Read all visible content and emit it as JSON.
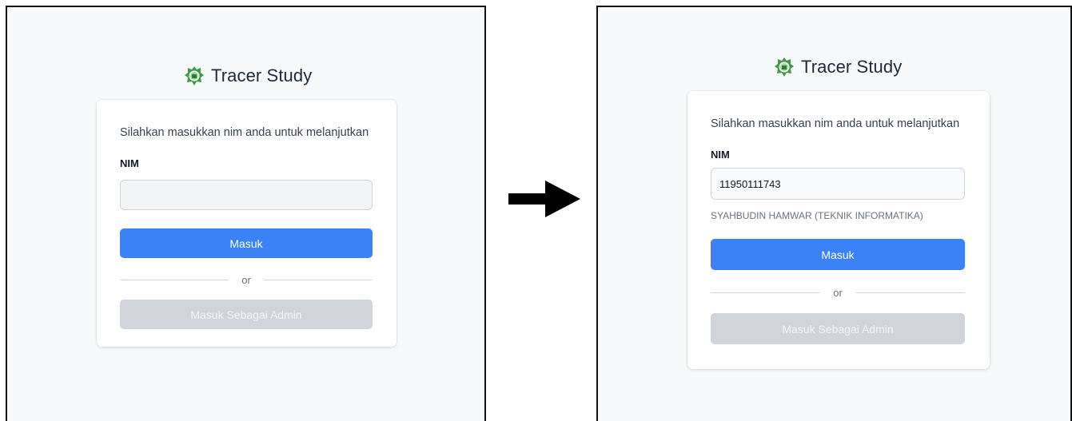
{
  "colors": {
    "primary": "#3b82f6",
    "disabled": "#d1d5db",
    "background": "#f8f9fb"
  },
  "before": {
    "brand": {
      "title": "Tracer Study",
      "logo_icon": "university-logo-icon"
    },
    "prompt": "Silahkan masukkan nim anda untuk melanjutkan",
    "nim_label": "NIM",
    "nim_value": "",
    "nim_placeholder": "",
    "login_button": "Masuk",
    "divider_text": "or",
    "admin_button": "Masuk Sebagai Admin"
  },
  "transition_icon": "arrow-right-icon",
  "after": {
    "brand": {
      "title": "Tracer Study",
      "logo_icon": "university-logo-icon"
    },
    "prompt": "Silahkan masukkan nim anda untuk melanjutkan",
    "nim_label": "NIM",
    "nim_value": "11950111743",
    "student_name": "SYAHBUDIN HAMWAR (TEKNIK INFORMATIKA)",
    "login_button": "Masuk",
    "divider_text": "or",
    "admin_button": "Masuk Sebagai Admin"
  }
}
